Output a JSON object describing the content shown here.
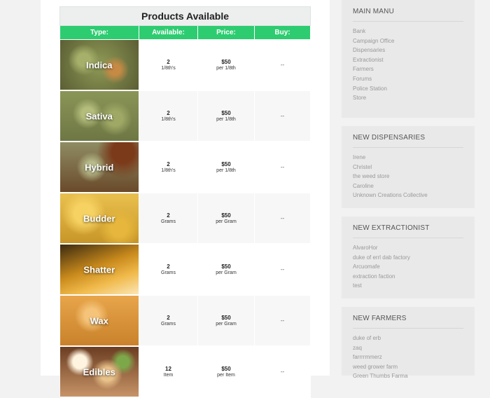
{
  "products_table": {
    "title": "Products Available",
    "headers": [
      "Type:",
      "Available:",
      "Price:",
      "Buy:"
    ],
    "rows": [
      {
        "type": "Indica",
        "available": "2",
        "available_unit": "1/8th's",
        "price": "$50",
        "price_unit": "per 1/8th",
        "buy": "--"
      },
      {
        "type": "Sativa",
        "available": "2",
        "available_unit": "1/8th's",
        "price": "$50",
        "price_unit": "per 1/8th",
        "buy": "--"
      },
      {
        "type": "Hybrid",
        "available": "2",
        "available_unit": "1/8th's",
        "price": "$50",
        "price_unit": "per 1/8th",
        "buy": "--"
      },
      {
        "type": "Budder",
        "available": "2",
        "available_unit": "Grams",
        "price": "$50",
        "price_unit": "per Gram",
        "buy": "--"
      },
      {
        "type": "Shatter",
        "available": "2",
        "available_unit": "Grams",
        "price": "$50",
        "price_unit": "per Gram",
        "buy": "--"
      },
      {
        "type": "Wax",
        "available": "2",
        "available_unit": "Grams",
        "price": "$50",
        "price_unit": "per Gram",
        "buy": "--"
      },
      {
        "type": "Edibles",
        "available": "12",
        "available_unit": "Item",
        "price": "$50",
        "price_unit": "per Item",
        "buy": "--"
      }
    ]
  },
  "sidebar": {
    "main_menu": {
      "title": "MAIN MANU",
      "items": [
        "Bank",
        "Campaign Office",
        "Dispensaries",
        "Extractionist",
        "Farmers",
        "Forums",
        "Police Station",
        "Store"
      ]
    },
    "new_dispensaries": {
      "title": "NEW DISPENSARIES",
      "items": [
        "Irene",
        "Christel",
        "the weed store",
        "Caroline",
        "Unknown Creations Collective"
      ]
    },
    "new_extractionist": {
      "title": "NEW EXTRACTIONIST",
      "items": [
        "AlvaroHor",
        "duke of errl dab factory",
        "Arcuomafe",
        "extraction faction",
        "test"
      ]
    },
    "new_farmers": {
      "title": "NEW FARMERS",
      "items": [
        "duke of erb",
        "zaq",
        "farrrrmmerz",
        "weed grower farm",
        "Green Thumbs Farma"
      ]
    }
  },
  "colors": {
    "header_green": "#2ecc71",
    "title_bg": "#ecefee",
    "sidebar_bg": "#e9e9e9",
    "page_bg": "#f2f2f2"
  }
}
